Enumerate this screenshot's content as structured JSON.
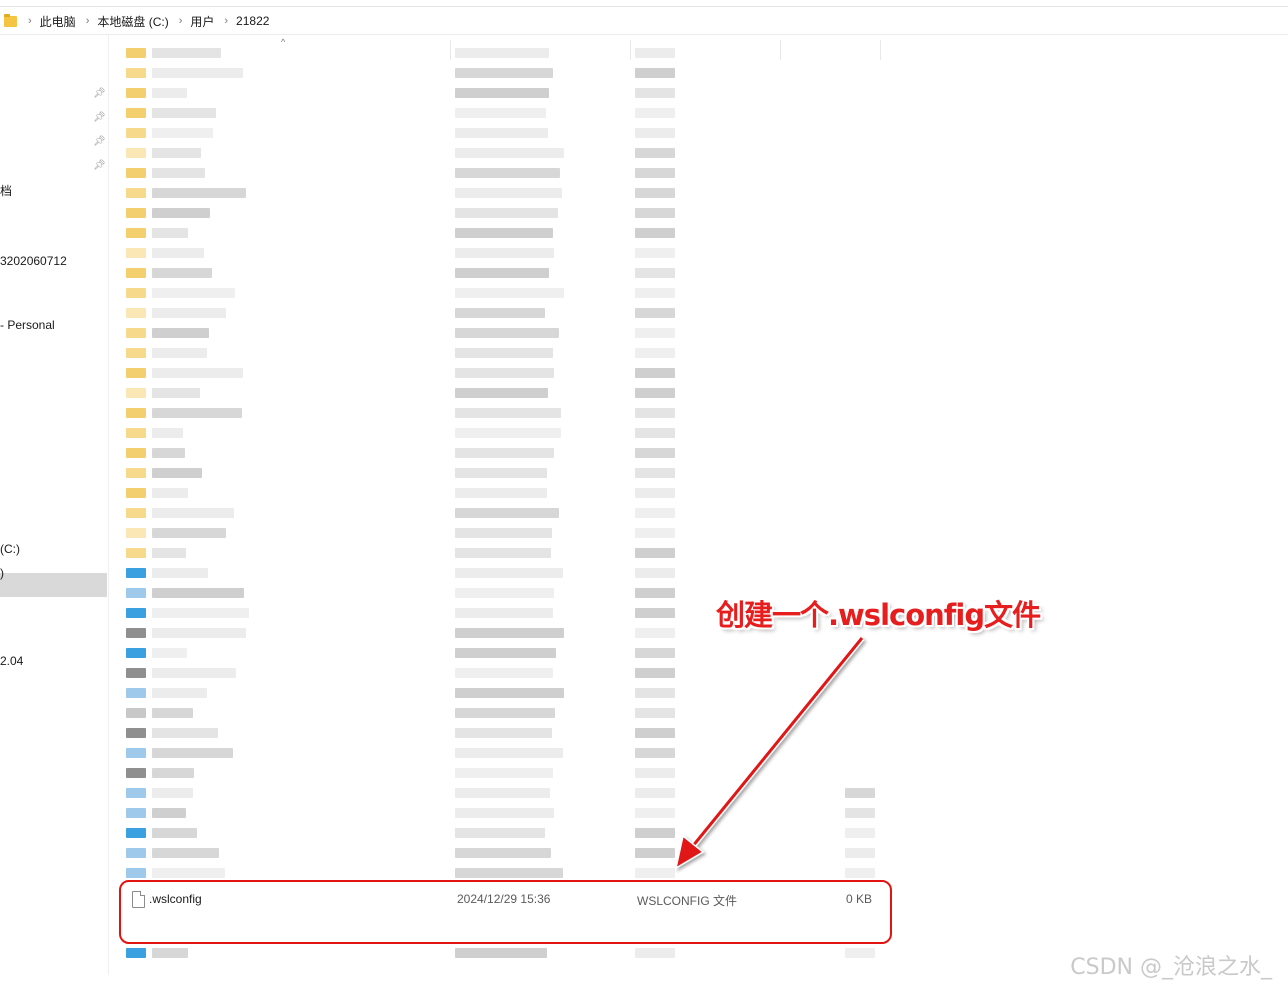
{
  "breadcrumb": {
    "items": [
      "此电脑",
      "本地磁盘 (C:)",
      "用户",
      "21822"
    ]
  },
  "sidebar": {
    "labels": [
      "档",
      "3202060712",
      "- Personal",
      "(C:)",
      ")",
      "2.04"
    ]
  },
  "file": {
    "name": ".wslconfig",
    "date": "2024/12/29 15:36",
    "type": "WSLCONFIG 文件",
    "size": "0 KB"
  },
  "annotation": {
    "text": "创建一个.wslconfig文件",
    "color": "#e61e1e"
  },
  "watermark": "CSDN @_沧浪之水_",
  "icons": {
    "breadcrumb": "folder-icon",
    "pin": "pin-icon",
    "file": "file-icon"
  }
}
